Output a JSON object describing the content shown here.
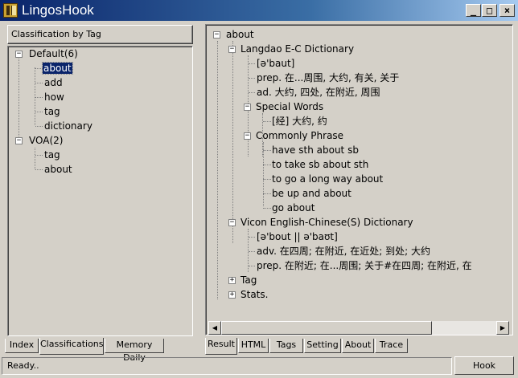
{
  "window": {
    "title": "LingosHook",
    "minimize": "_",
    "maximize": "□",
    "close": "×"
  },
  "left_panel": {
    "header": "Classification by Tag",
    "groups": [
      {
        "label": "Default(6)",
        "items": [
          "about",
          "add",
          "how",
          "tag",
          "dictionary"
        ]
      },
      {
        "label": "VOA(2)",
        "items": [
          "tag",
          "about"
        ]
      }
    ],
    "tabs": [
      "Index",
      "Classifications",
      "Memory Daily"
    ]
  },
  "result_tree": {
    "root": "about",
    "langdao": {
      "title": "Langdao E-C Dictionary",
      "phonetic": "[ə'baut]",
      "prep": "prep. 在...周围, 大约, 有关, 关于",
      "ad": "ad. 大约, 四处, 在附近, 周围",
      "special_words": {
        "title": "Special Words",
        "entry": "[经] 大约, 约"
      },
      "commonly_phrase": {
        "title": "Commonly Phrase",
        "items": [
          "have sth about sb",
          "to take sb about sth",
          "to go a long way about",
          "be up and about",
          "go about"
        ]
      }
    },
    "vicon": {
      "title": "Vicon English-Chinese(S) Dictionary",
      "phonetic": "[ə'bout || ə'baʊt]",
      "adv": "adv. 在四周; 在附近, 在近处; 到处; 大约",
      "prep": "prep. 在附近; 在...周围; 关于#在四周; 在附近, 在"
    },
    "tag": "Tag",
    "stats": "Stats."
  },
  "right_tabs": [
    "Result",
    "HTML",
    "Tags",
    "Setting",
    "About",
    "Trace"
  ],
  "status": {
    "text": "Ready..",
    "hook_button": "Hook"
  }
}
